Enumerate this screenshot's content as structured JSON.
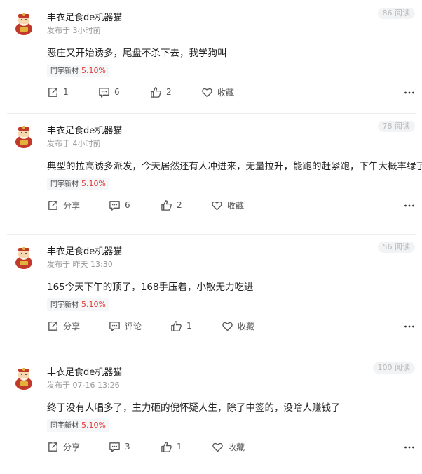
{
  "posts": [
    {
      "username": "丰衣足食de机器猫",
      "time": "发布于 3小时前",
      "reads": "86 阅读",
      "content": "恶庄又开始诱多，尾盘不杀下去，我学狗叫",
      "stock_name": "同宇新材",
      "stock_change": "5.10%",
      "share_label": "1",
      "comment_label": "6",
      "like_label": "2",
      "fav_label": "收藏"
    },
    {
      "username": "丰衣足食de机器猫",
      "time": "发布于 4小时前",
      "reads": "78 阅读",
      "content": "典型的拉高诱多派发，今天居然还有人冲进来，无量拉升，能跑的赶紧跑，下午大概率绿了",
      "stock_name": "同宇新材",
      "stock_change": "5.10%",
      "share_label": "分享",
      "comment_label": "6",
      "like_label": "2",
      "fav_label": "收藏"
    },
    {
      "username": "丰衣足食de机器猫",
      "time": "发布于 昨天 13:30",
      "reads": "56 阅读",
      "content": "165今天下午的顶了，168手压着，小散无力吃进",
      "stock_name": "同宇新材",
      "stock_change": "5.10%",
      "share_label": "分享",
      "comment_label": "评论",
      "like_label": "1",
      "fav_label": "收藏"
    },
    {
      "username": "丰衣足食de机器猫",
      "time": "发布于 07-16 13:26",
      "reads": "100 阅读",
      "content": "终于没有人唱多了，主力砸的倪怀疑人生，除了中签的，没啥人赚钱了",
      "stock_name": "同宇新材",
      "stock_change": "5.10%",
      "share_label": "分享",
      "comment_label": "3",
      "like_label": "1",
      "fav_label": "收藏"
    }
  ],
  "colors": {
    "stock_change": "#e53935",
    "avatar_red": "#c0392b",
    "avatar_gold": "#e3b23c"
  },
  "icons": [
    "avatar-caishen",
    "share-icon",
    "comment-icon",
    "like-icon",
    "heart-icon",
    "more-icon"
  ]
}
